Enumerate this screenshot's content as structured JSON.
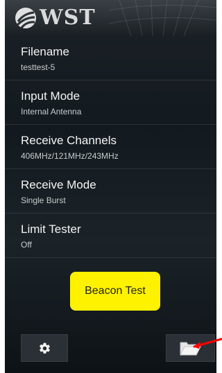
{
  "header": {
    "logo_text": "WST"
  },
  "menu": {
    "items": [
      {
        "title": "Filename",
        "value": "testtest-5"
      },
      {
        "title": "Input Mode",
        "value": "Internal Antenna"
      },
      {
        "title": "Receive Channels",
        "value": "406MHz/121MHz/243MHz"
      },
      {
        "title": "Receive Mode",
        "value": "Single Burst"
      },
      {
        "title": "Limit Tester",
        "value": "Off"
      }
    ]
  },
  "actions": {
    "beacon_test_label": "Beacon Test"
  },
  "icons": {
    "settings": "gear-icon",
    "folder": "folder-icon",
    "logo": "wst-logo-icon",
    "annotation": "red-arrow-icon"
  },
  "colors": {
    "beacon_button": "#fff200",
    "annotation_arrow": "#ff0000"
  }
}
